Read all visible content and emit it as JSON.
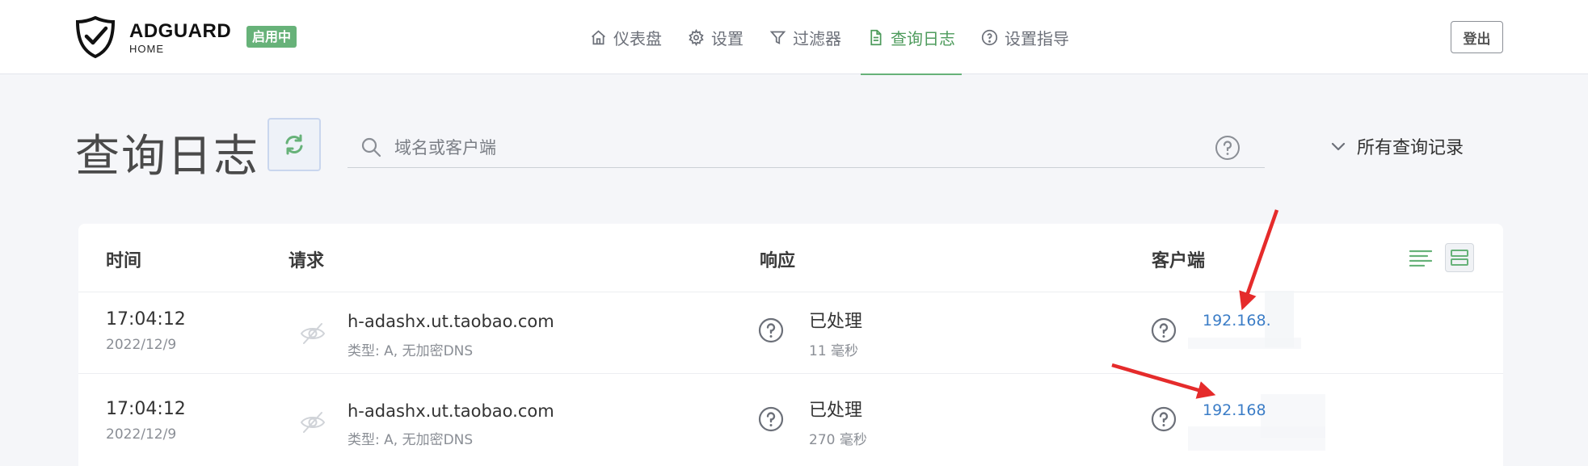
{
  "header": {
    "brand_name": "ADGUARD",
    "brand_sub": "HOME",
    "status_badge": "启用中",
    "nav": [
      {
        "label": "仪表盘",
        "icon": "home-icon"
      },
      {
        "label": "设置",
        "icon": "gear-icon"
      },
      {
        "label": "过滤器",
        "icon": "filter-icon"
      },
      {
        "label": "查询日志",
        "icon": "document-icon",
        "active": true
      },
      {
        "label": "设置指导",
        "icon": "help-icon"
      }
    ],
    "logout_label": "登出"
  },
  "page": {
    "title": "查询日志",
    "search_placeholder": "域名或客户端",
    "search_value": "",
    "filter_label": "所有查询记录"
  },
  "table": {
    "headers": {
      "time": "时间",
      "request": "请求",
      "response": "响应",
      "client": "客户端"
    },
    "rows": [
      {
        "time": "17:04:12",
        "date": "2022/12/9",
        "domain": "h-adashx.ut.taobao.com",
        "type": "类型: A, 无加密DNS",
        "status": "已处理",
        "elapsed": "11 毫秒",
        "client": "192.168."
      },
      {
        "time": "17:04:12",
        "date": "2022/12/9",
        "domain": "h-adashx.ut.taobao.com",
        "type": "类型: A, 无加密DNS",
        "status": "已处理",
        "elapsed": "270 毫秒",
        "client": "192.168"
      }
    ]
  },
  "colors": {
    "accent": "#67b279",
    "link": "#3b7dc7",
    "annotation": "#e52b2b"
  }
}
